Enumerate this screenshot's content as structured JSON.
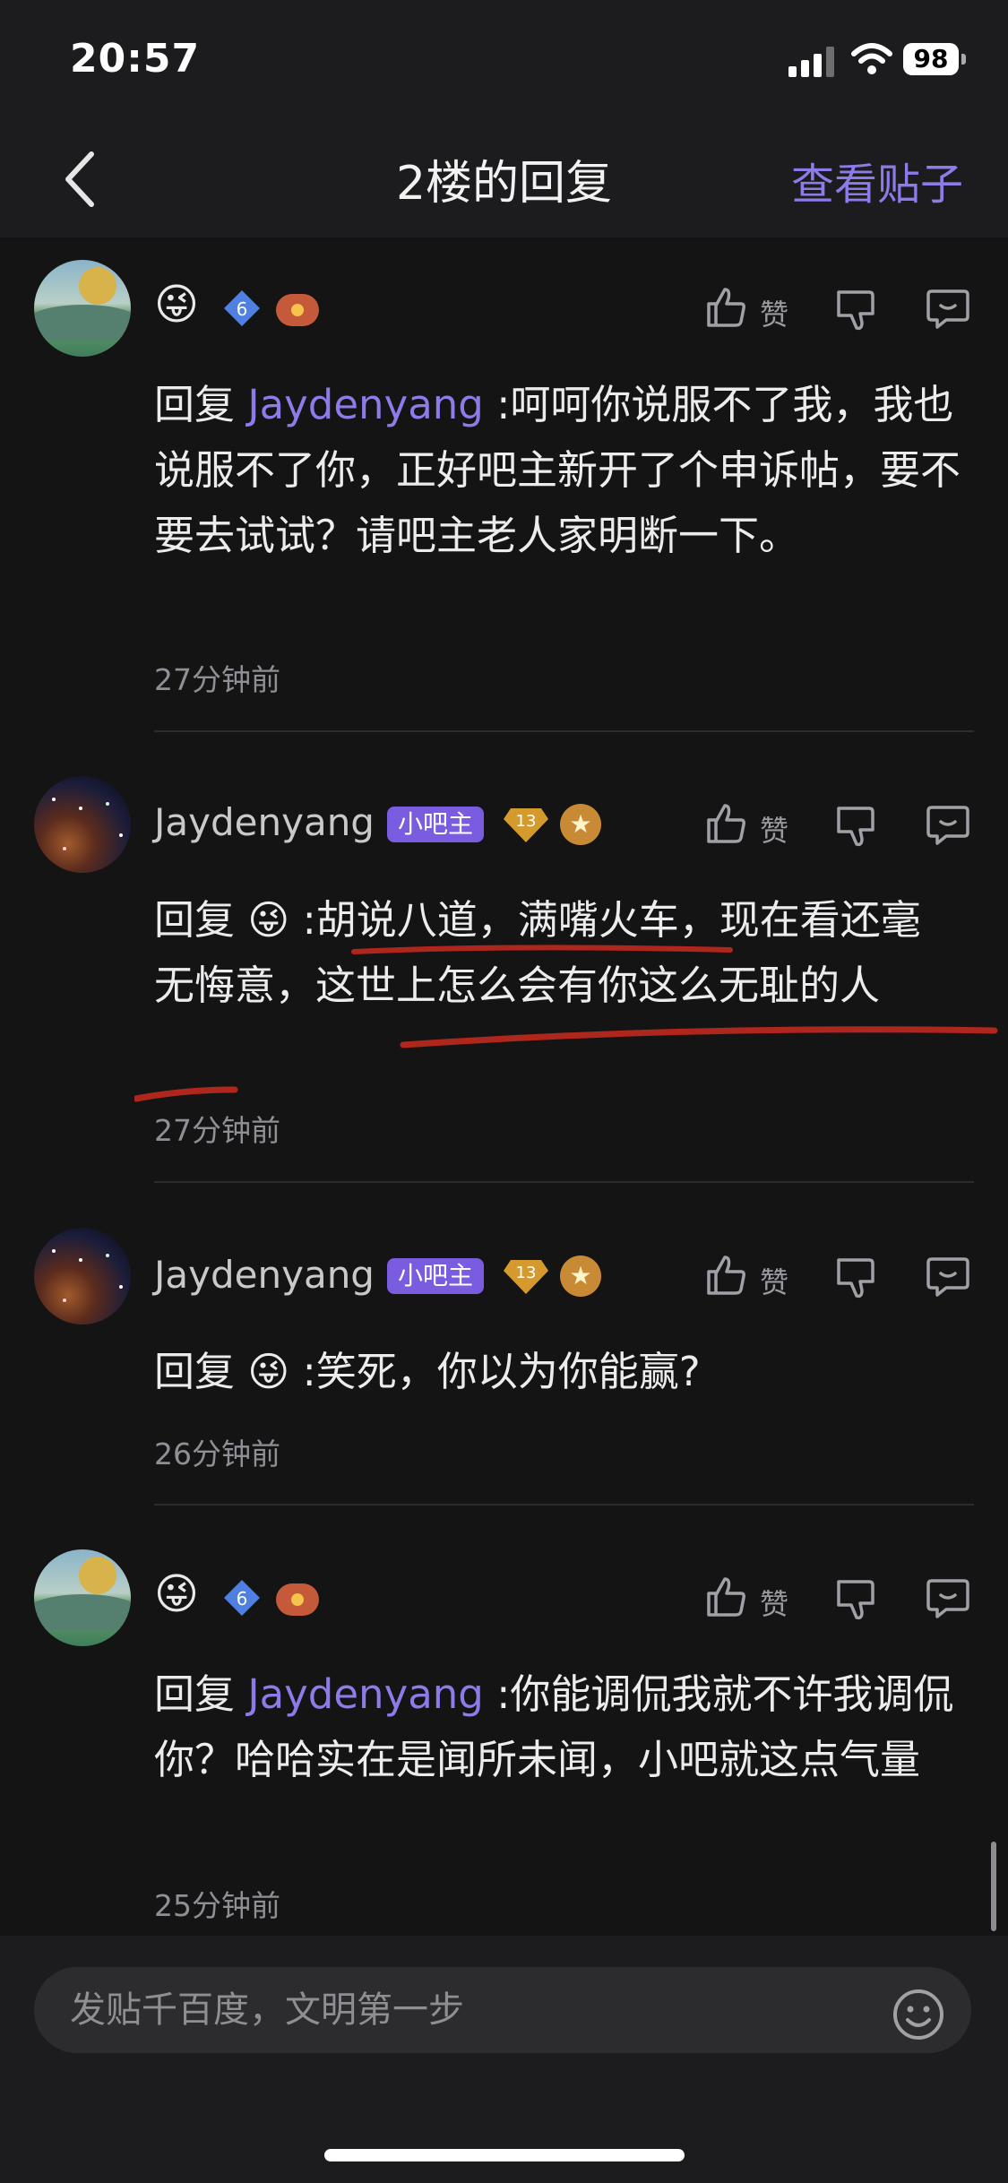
{
  "status_bar": {
    "time": "20:57",
    "battery": "98"
  },
  "nav": {
    "title": "2楼的回复",
    "view_post": "查看贴子"
  },
  "actions": {
    "like_label": "赞"
  },
  "icons": [
    "chevron-left-icon",
    "thumbs-up-icon",
    "thumbs-down-icon",
    "comment-icon",
    "smiley-icon",
    "signal-icon",
    "wifi-icon",
    "battery-icon"
  ],
  "replies": [
    {
      "user": "",
      "avatar": "landscape",
      "emoji": "😜",
      "level": "6",
      "reply_prefix": "回复",
      "mention": "Jaydenyang",
      "text": ":呵呵你说服不了我，我也说服不了你，正好吧主新开了个申诉帖，要不要去试试？请吧主老人家明断一下。",
      "time": "27分钟前"
    },
    {
      "user": "Jaydenyang",
      "avatar": "space",
      "badge": "小吧主",
      "level": "13",
      "reply_prefix": "回复",
      "mention_emoji": "😜",
      "text": ":胡说八道，满嘴火车，现在看还毫无悔意，这世上怎么会有你这么无耻的人",
      "time": "27分钟前"
    },
    {
      "user": "Jaydenyang",
      "avatar": "space",
      "badge": "小吧主",
      "level": "13",
      "reply_prefix": "回复",
      "mention_emoji": "😜",
      "text": ":笑死，你以为你能赢?",
      "time": "26分钟前"
    },
    {
      "user": "",
      "avatar": "landscape",
      "emoji": "😜",
      "level": "6",
      "reply_prefix": "回复",
      "mention": "Jaydenyang",
      "text": ":你能调侃我就不许我调侃你？哈哈实在是闻所未闻，小吧就这点气量",
      "time": "25分钟前"
    }
  ],
  "composer": {
    "placeholder": "发贴千百度，文明第一步"
  },
  "colors": {
    "accent": "#8d7be8",
    "admin_badge": "#7a5ce0",
    "underline": "#c0281e"
  }
}
